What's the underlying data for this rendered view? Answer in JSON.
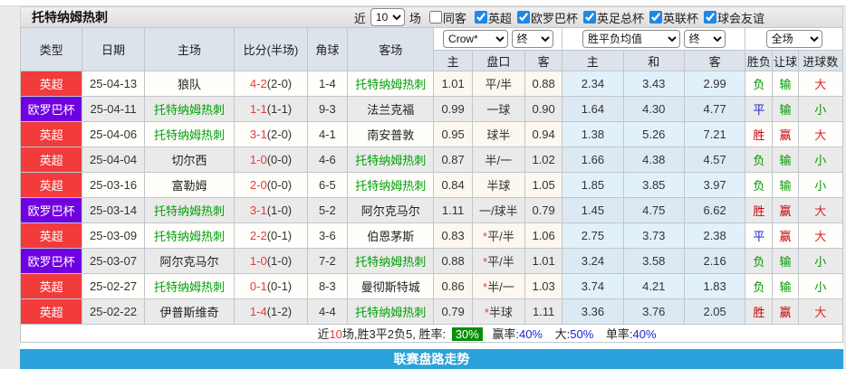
{
  "toolbar": {
    "title": "托特纳姆热刺",
    "recent_label": "近",
    "recent_value": "10",
    "matches_label": "场",
    "same_venue_label": "同客",
    "same_venue_checked": false,
    "checkbox_accent": "#1e88e5",
    "leagues": [
      {
        "label": "英超",
        "checked": true
      },
      {
        "label": "欧罗巴杯",
        "checked": true
      },
      {
        "label": "英足总杯",
        "checked": true
      },
      {
        "label": "英联杯",
        "checked": true
      },
      {
        "label": "球会友谊",
        "checked": true
      }
    ]
  },
  "table": {
    "static_headers": [
      "类型",
      "日期",
      "主场",
      "比分(半场)",
      "角球",
      "客场"
    ],
    "handicap_group": {
      "company_select": "Crow*",
      "final_select": "终",
      "sub_headers": [
        "主",
        "盘口",
        "客"
      ]
    },
    "wdl_group": {
      "avg_select": "胜平负均值",
      "final_select": "终",
      "sub_headers": [
        "主",
        "和",
        "客"
      ]
    },
    "fulltime_group": {
      "scope_select": "全场",
      "sub_headers": [
        "胜负",
        "让球",
        "进球数"
      ]
    },
    "league_colors": {
      "英超": "#f23b3b",
      "欧罗巴杯": "#6f00e0"
    },
    "highlight_team_color": "#00a006",
    "normal_team_color": "#222222",
    "score_color": "#e93a3a",
    "star_color": "#e93a3a",
    "result_colors": {
      "胜": "#cc0000",
      "平": "#2222cc",
      "负": "#009900",
      "赢": "#cc0000",
      "输": "#009900",
      "大": "#dd2222",
      "小": "#009900"
    },
    "rows": [
      {
        "league": "英超",
        "date": "25-04-13",
        "home": "狼队",
        "home_hl": false,
        "score": "4-2",
        "half": "(2-0)",
        "corner": "1-4",
        "away": "托特纳姆热刺",
        "away_hl": true,
        "h": "1.01",
        "star": false,
        "handicap": "平/半",
        "a": "0.88",
        "w": "2.34",
        "d": "3.43",
        "l": "2.99",
        "results": [
          "负",
          "输",
          "大"
        ]
      },
      {
        "league": "欧罗巴杯",
        "date": "25-04-11",
        "home": "托特纳姆热刺",
        "home_hl": true,
        "score": "1-1",
        "half": "(1-1)",
        "corner": "9-3",
        "away": "法兰克福",
        "away_hl": false,
        "h": "0.99",
        "star": false,
        "handicap": "一球",
        "a": "0.90",
        "w": "1.64",
        "d": "4.30",
        "l": "4.77",
        "results": [
          "平",
          "输",
          "小"
        ]
      },
      {
        "league": "英超",
        "date": "25-04-06",
        "home": "托特纳姆热刺",
        "home_hl": true,
        "score": "3-1",
        "half": "(2-0)",
        "corner": "4-1",
        "away": "南安普敦",
        "away_hl": false,
        "h": "0.95",
        "star": false,
        "handicap": "球半",
        "a": "0.94",
        "w": "1.38",
        "d": "5.26",
        "l": "7.21",
        "results": [
          "胜",
          "赢",
          "大"
        ]
      },
      {
        "league": "英超",
        "date": "25-04-04",
        "home": "切尔西",
        "home_hl": false,
        "score": "1-0",
        "half": "(0-0)",
        "corner": "4-6",
        "away": "托特纳姆热刺",
        "away_hl": true,
        "h": "0.87",
        "star": false,
        "handicap": "半/一",
        "a": "1.02",
        "w": "1.66",
        "d": "4.38",
        "l": "4.57",
        "results": [
          "负",
          "输",
          "小"
        ]
      },
      {
        "league": "英超",
        "date": "25-03-16",
        "home": "富勒姆",
        "home_hl": false,
        "score": "2-0",
        "half": "(0-0)",
        "corner": "6-5",
        "away": "托特纳姆热刺",
        "away_hl": true,
        "h": "0.84",
        "star": false,
        "handicap": "半球",
        "a": "1.05",
        "w": "1.85",
        "d": "3.85",
        "l": "3.97",
        "results": [
          "负",
          "输",
          "小"
        ]
      },
      {
        "league": "欧罗巴杯",
        "date": "25-03-14",
        "home": "托特纳姆热刺",
        "home_hl": true,
        "score": "3-1",
        "half": "(1-0)",
        "corner": "5-2",
        "away": "阿尔克马尔",
        "away_hl": false,
        "h": "1.11",
        "star": false,
        "handicap": "一/球半",
        "a": "0.79",
        "w": "1.45",
        "d": "4.75",
        "l": "6.62",
        "results": [
          "胜",
          "赢",
          "大"
        ]
      },
      {
        "league": "英超",
        "date": "25-03-09",
        "home": "托特纳姆热刺",
        "home_hl": true,
        "score": "2-2",
        "half": "(0-1)",
        "corner": "3-6",
        "away": "伯恩茅斯",
        "away_hl": false,
        "h": "0.83",
        "star": true,
        "handicap": "平/半",
        "a": "1.06",
        "w": "2.75",
        "d": "3.73",
        "l": "2.38",
        "results": [
          "平",
          "赢",
          "大"
        ]
      },
      {
        "league": "欧罗巴杯",
        "date": "25-03-07",
        "home": "阿尔克马尔",
        "home_hl": false,
        "score": "1-0",
        "half": "(1-0)",
        "corner": "7-2",
        "away": "托特纳姆热刺",
        "away_hl": true,
        "h": "0.88",
        "star": true,
        "handicap": "平/半",
        "a": "1.01",
        "w": "3.24",
        "d": "3.58",
        "l": "2.16",
        "results": [
          "负",
          "输",
          "小"
        ]
      },
      {
        "league": "英超",
        "date": "25-02-27",
        "home": "托特纳姆热刺",
        "home_hl": true,
        "score": "0-1",
        "half": "(0-1)",
        "corner": "8-3",
        "away": "曼彻斯特城",
        "away_hl": false,
        "h": "0.86",
        "star": true,
        "handicap": "半/一",
        "a": "1.03",
        "w": "3.74",
        "d": "4.21",
        "l": "1.83",
        "results": [
          "负",
          "输",
          "小"
        ]
      },
      {
        "league": "英超",
        "date": "25-02-22",
        "home": "伊普斯维奇",
        "home_hl": false,
        "score": "1-4",
        "half": "(1-2)",
        "corner": "4-4",
        "away": "托特纳姆热刺",
        "away_hl": true,
        "h": "0.79",
        "star": true,
        "handicap": "半球",
        "a": "1.11",
        "w": "3.36",
        "d": "3.76",
        "l": "2.05",
        "results": [
          "胜",
          "赢",
          "大"
        ]
      }
    ]
  },
  "summary": {
    "prefix": "近",
    "count": "10",
    "count_color": "#e93a3a",
    "middle": "场,胜3平2负5, 胜率:",
    "win_rate": "30%",
    "win_rate_bg": "#0a8f0a",
    "stat_value_color": "#2222cc",
    "stats": [
      {
        "label": "赢率:",
        "value": "40%"
      },
      {
        "label": "大:",
        "value": "50%"
      },
      {
        "label": "单率:",
        "value": "40%"
      }
    ]
  },
  "footer": {
    "label": "联赛盘路走势",
    "bg": "#2aa1da"
  }
}
